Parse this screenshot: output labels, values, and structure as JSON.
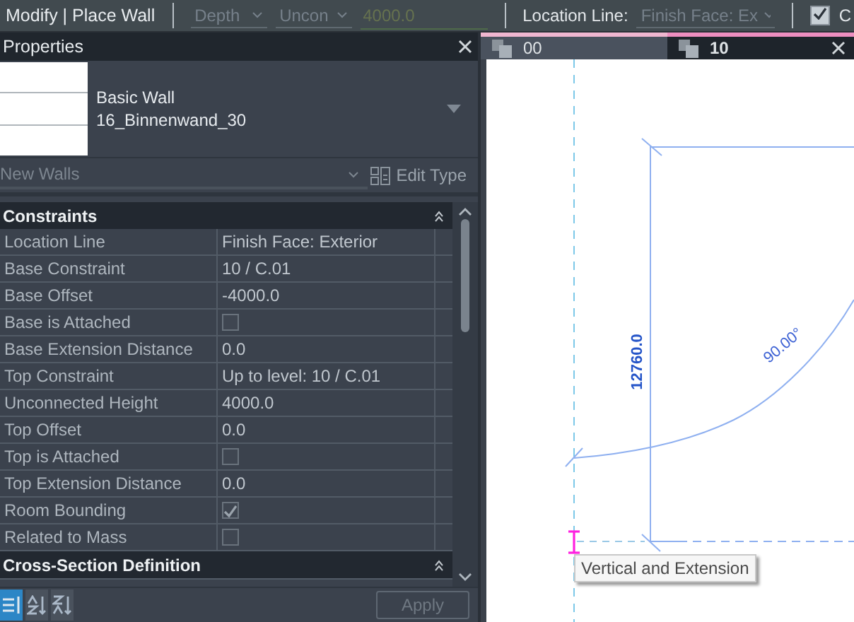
{
  "ribbon": {
    "context_title": "Modify | Place Wall",
    "depth_dropdown": "Depth",
    "height_dropdown": "Uncon",
    "height_field": {
      "value": "4000.0",
      "disabled": true
    },
    "location_line_label": "Location Line:",
    "location_line_dropdown": "Finish Face: Ex",
    "chain_checkbox": {
      "label": "C",
      "checked": true
    }
  },
  "properties": {
    "title": "Properties",
    "type_family": "Basic Wall",
    "type_name": "16_Binnenwand_30",
    "instance_filter": "New Walls",
    "edit_type_button": "Edit Type",
    "groups": [
      {
        "title": "Constraints",
        "rows": [
          {
            "kind": "text",
            "name": "Location Line",
            "value": "Finish Face: Exterior"
          },
          {
            "kind": "text",
            "name": "Base Constraint",
            "value": "10 / C.01"
          },
          {
            "kind": "text",
            "name": "Base Offset",
            "value": "-4000.0"
          },
          {
            "kind": "checkbox",
            "name": "Base is Attached",
            "checked": false
          },
          {
            "kind": "text",
            "name": "Base Extension Distance",
            "value": "0.0"
          },
          {
            "kind": "text",
            "name": "Top Constraint",
            "value": "Up to level: 10 / C.01"
          },
          {
            "kind": "text",
            "name": "Unconnected Height",
            "value": "4000.0"
          },
          {
            "kind": "text",
            "name": "Top Offset",
            "value": "0.0"
          },
          {
            "kind": "checkbox",
            "name": "Top is Attached",
            "checked": false
          },
          {
            "kind": "text",
            "name": "Top Extension Distance",
            "value": "0.0"
          },
          {
            "kind": "checkbox",
            "name": "Room Bounding",
            "checked": true
          },
          {
            "kind": "checkbox",
            "name": "Related to Mass",
            "checked": false
          }
        ]
      },
      {
        "title": "Cross-Section Definition"
      }
    ],
    "sort_buttons": [
      {
        "kind": "grouped",
        "selected": true
      },
      {
        "kind": "ascending",
        "selected": false
      },
      {
        "kind": "descending",
        "selected": false
      }
    ],
    "apply_button": {
      "label": "Apply",
      "disabled": true
    }
  },
  "view_tabs": [
    {
      "label": "00",
      "selected": false
    },
    {
      "label": "10",
      "selected": true
    }
  ],
  "canvas": {
    "dimension": "12760.0",
    "angle": "90.00°",
    "tooltip": "Vertical and Extension"
  }
}
